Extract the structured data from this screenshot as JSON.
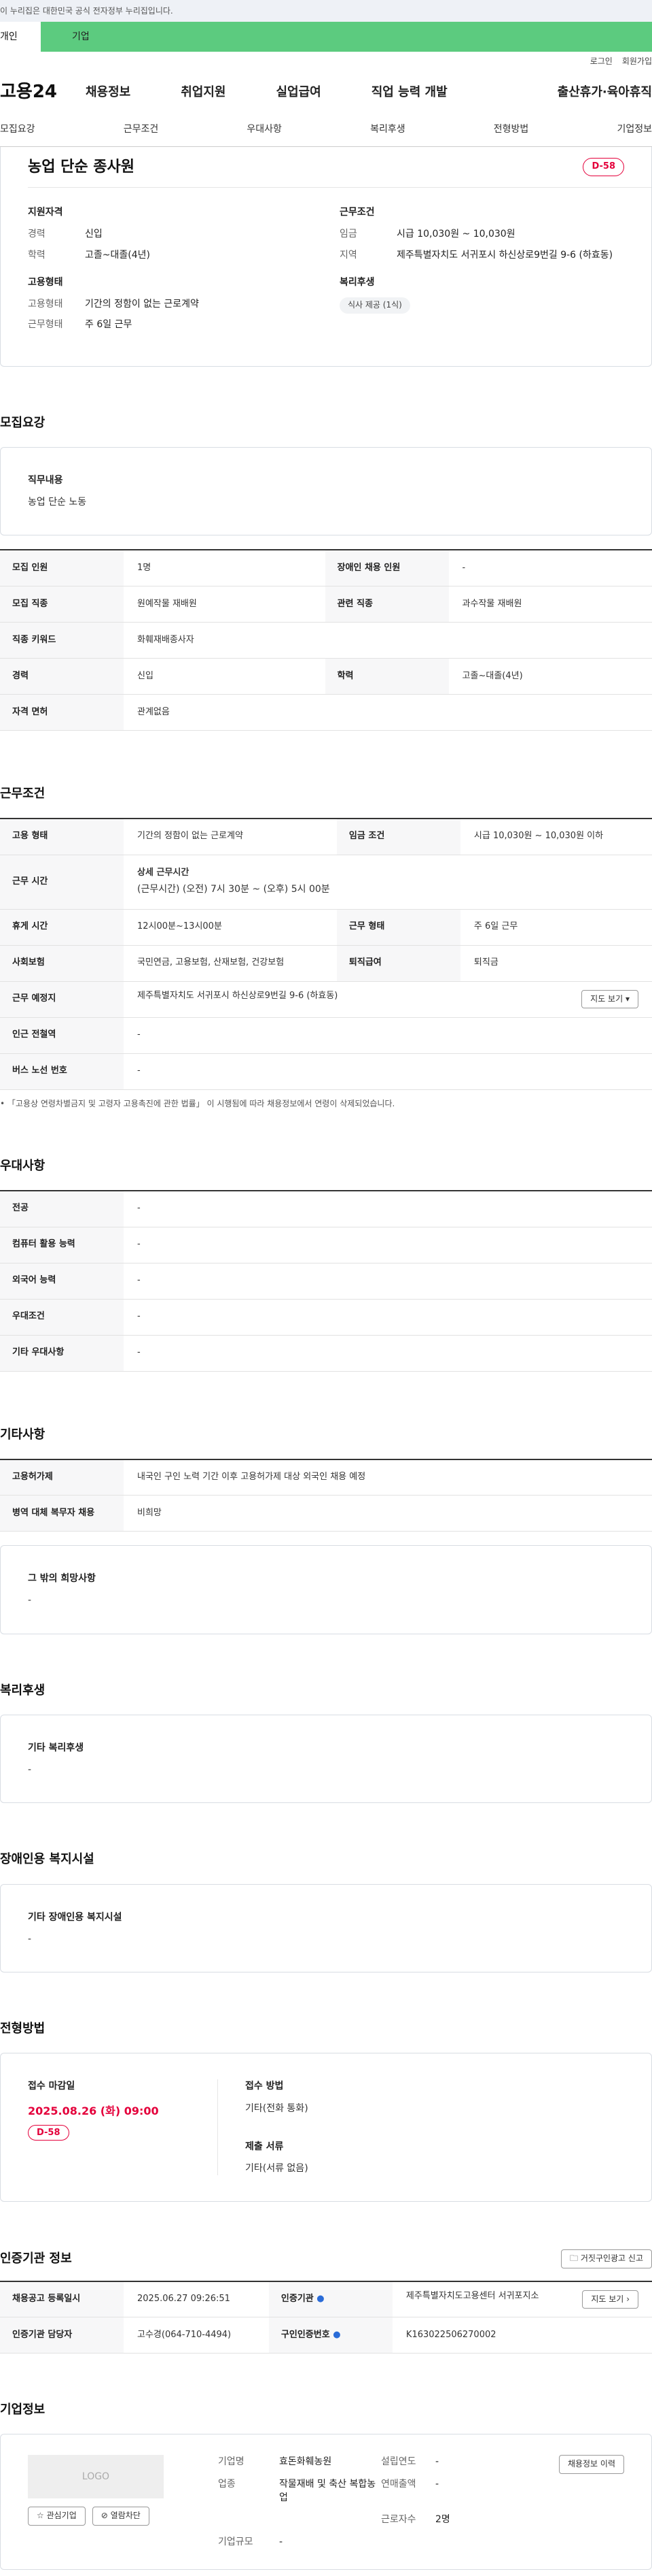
{
  "gov_banner": "이 누리집은 대한민국 공식 전자정부 누리집입니다.",
  "user_tabs": [
    "개인",
    "기업"
  ],
  "topbar": {
    "login": "로그인",
    "signup": "회원가입"
  },
  "gnb": {
    "logo": "고용24",
    "items": [
      "채용정보",
      "취업지원",
      "실업급여",
      "직업 능력 개발",
      "출산휴가·육아휴직"
    ]
  },
  "subnav": [
    "모집요강",
    "근무조건",
    "우대사항",
    "복리후생",
    "전형방법",
    "기업정보"
  ],
  "summary": {
    "title": "농업 단순 종사원",
    "dday": "D-58",
    "qual_title": "지원자격",
    "qual": [
      {
        "k": "경력",
        "v": "신입"
      },
      {
        "k": "학력",
        "v": "고졸~대졸(4년)"
      }
    ],
    "emp_title": "고용형태",
    "emp": [
      {
        "k": "고용형태",
        "v": "기간의 정함이 없는 근로계약"
      },
      {
        "k": "근무형태",
        "v": "주 6일 근무"
      }
    ],
    "cond_title": "근무조건",
    "cond": [
      {
        "k": "임금",
        "v": "시급 10,030원 ~ 10,030원"
      },
      {
        "k": "지역",
        "v": "제주특별자치도 서귀포시 하신상로9번길 9-6 (하효동)"
      }
    ],
    "welfare_title": "복리후생",
    "welfare_chip": "식사 제공 (1식)"
  },
  "recruit": {
    "title": "모집요강",
    "duty_title": "직무내용",
    "duty": "농업 단순 노동",
    "rows": [
      [
        "모집 인원",
        "1명",
        "장애인 채용 인원",
        "-"
      ],
      [
        "모집 직종",
        "원예작물 재배원",
        "관련 직종",
        "과수작물 재배원"
      ],
      [
        "직종 키워드",
        "화훼재배종사자",
        "",
        ""
      ],
      [
        "경력",
        "신입",
        "학력",
        "고졸~대졸(4년)"
      ],
      [
        "자격 면허",
        "관계없음",
        "",
        ""
      ]
    ]
  },
  "work": {
    "title": "근무조건",
    "type_k": "고용 형태",
    "type_v": "기간의 정함이 없는 근로계약",
    "wage_k": "임금 조건",
    "wage_v": "시급 10,030원 ~ 10,030원 이하",
    "time_k": "근무 시간",
    "time_sub": "상세 근무시간",
    "time_v": "(근무시간) (오전) 7시 30분 ~ (오후) 5시 00분",
    "rest_k": "휴게 시간",
    "rest_v": "12시00분~13시00분",
    "shift_k": "근무 형태",
    "shift_v": "주 6일 근무",
    "ins_k": "사회보험",
    "ins_v": "국민연금, 고용보험, 산재보험, 건강보험",
    "retire_k": "퇴직급여",
    "retire_v": "퇴직금",
    "place_k": "근무 예정지",
    "place_v": "제주특별자치도 서귀포시 하신상로9번길 9-6 (하효동)",
    "map_btn": "지도 보기",
    "subway_k": "인근 전철역",
    "subway_v": "-",
    "bus_k": "버스 노선 번호",
    "bus_v": "-",
    "note": "「고용상 연령차별금지 및 고령자 고용촉진에 관한 법률」 이 시행됨에 따라 채용정보에서 연령이 삭제되었습니다."
  },
  "pref": {
    "title": "우대사항",
    "rows": [
      [
        "전공",
        "-"
      ],
      [
        "컴퓨터 활용 능력",
        "-"
      ],
      [
        "외국어 능력",
        "-"
      ],
      [
        "우대조건",
        "-"
      ],
      [
        "기타 우대사항",
        "-"
      ]
    ]
  },
  "etc": {
    "title": "기타사항",
    "rows": [
      [
        "고용허가제",
        "내국인 구인 노력 기간 이후 고용허가제 대상 외국인 채용 예정"
      ],
      [
        "병역 대체 복무자 채용",
        "비희망"
      ]
    ],
    "wish_title": "그 밖의 희망사항",
    "wish": "-"
  },
  "welfare": {
    "title": "복리후생",
    "box_title": "기타 복리후생",
    "box_text": "-"
  },
  "disabled": {
    "title": "장애인용 복지시설",
    "box_title": "기타 장애인용 복지시설",
    "box_text": "-"
  },
  "method": {
    "title": "전형방법",
    "deadline_label": "접수 마감일",
    "deadline": "2025.08.26 (화) 09:00",
    "dday": "D-58",
    "way_label": "접수 방법",
    "way": "기타(전화 통화)",
    "docs_label": "제출 서류",
    "docs": "기타(서류 없음)"
  },
  "agency": {
    "title": "인증기관 정보",
    "report_btn": "거짓구인광고 신고",
    "reg_k": "채용공고 등록일시",
    "reg_v": "2025.06.27 09:26:51",
    "org_k": "인증기관",
    "org_v": "제주특별자치도고용센터 서귀포지소",
    "map_btn": "지도 보기",
    "mgr_k": "인증기관 담당자",
    "mgr_v": "고수경(064-710-4494)",
    "no_k": "구인인증번호",
    "no_v": "K163022506270002"
  },
  "company": {
    "title": "기업정보",
    "logo": "LOGO",
    "fav_btn": "관심기업",
    "block_btn": "열람차단",
    "history_btn": "채용정보 이력",
    "name_k": "기업명",
    "name_v": "효돈화훼농원",
    "founded_k": "설립연도",
    "founded_v": "-",
    "ind_k": "업종",
    "ind_v": "작물재배 및 축산 복합농업",
    "sales_k": "연매출액",
    "sales_v": "-",
    "emp_k": "근로자수",
    "emp_v": "2명",
    "size_k": "기업규모",
    "size_v": "-"
  }
}
